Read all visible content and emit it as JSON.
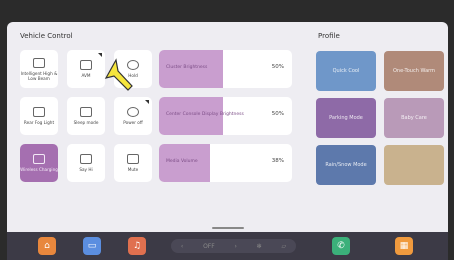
{
  "vehicle_control": {
    "title": "Vehicle Control",
    "tiles": [
      {
        "label": "Intelligent High & Low Beam",
        "icon": "headlight-icon",
        "active": false
      },
      {
        "label": "AVM",
        "icon": "camera-car-icon",
        "active": false
      },
      {
        "label": "Hold",
        "icon": "hold-brake-icon",
        "active": false
      },
      {
        "label": "Rear Fog Light",
        "icon": "fog-light-icon",
        "active": false
      },
      {
        "label": "Sleep mode",
        "icon": "sleep-mode-icon",
        "active": false
      },
      {
        "label": "Power off",
        "icon": "power-icon",
        "active": false
      },
      {
        "label": "Wireless Charging",
        "icon": "wireless-charging-icon",
        "active": true
      },
      {
        "label": "Say Hi",
        "icon": "say-hi-icon",
        "active": false
      },
      {
        "label": "Mute",
        "icon": "speaker-mute-icon",
        "active": false
      }
    ],
    "sliders": [
      {
        "label": "Cluster Brightness",
        "value": "50%",
        "level": 0.48
      },
      {
        "label": "Center Console Display Brightness",
        "value": "50%",
        "level": 0.48
      },
      {
        "label": "Media Volume",
        "value": "38%",
        "level": 0.38
      }
    ]
  },
  "profile": {
    "title": "Profile",
    "modes": [
      {
        "label": "Quick Cool",
        "color": "#6f97c9"
      },
      {
        "label": "One-Touch Warm",
        "color": "#b08a79"
      },
      {
        "label": "Parking Mode",
        "color": "#8e6aa7"
      },
      {
        "label": "Baby Care",
        "color": "#b99ab8"
      },
      {
        "label": "Rain/Snow Mode",
        "color": "#5d79ac"
      },
      {
        "label": "",
        "color": "#c9b28e"
      }
    ]
  },
  "dock": {
    "climate_label": "OFF",
    "apps": [
      {
        "name": "home-app",
        "color": "#e8873d"
      },
      {
        "name": "car-app",
        "color": "#5b8ee0"
      },
      {
        "name": "music-app",
        "color": "#e0704f"
      },
      {
        "name": "phone-app",
        "color": "#3bb07a"
      },
      {
        "name": "apps-app",
        "color": "#f09a3e"
      }
    ]
  }
}
